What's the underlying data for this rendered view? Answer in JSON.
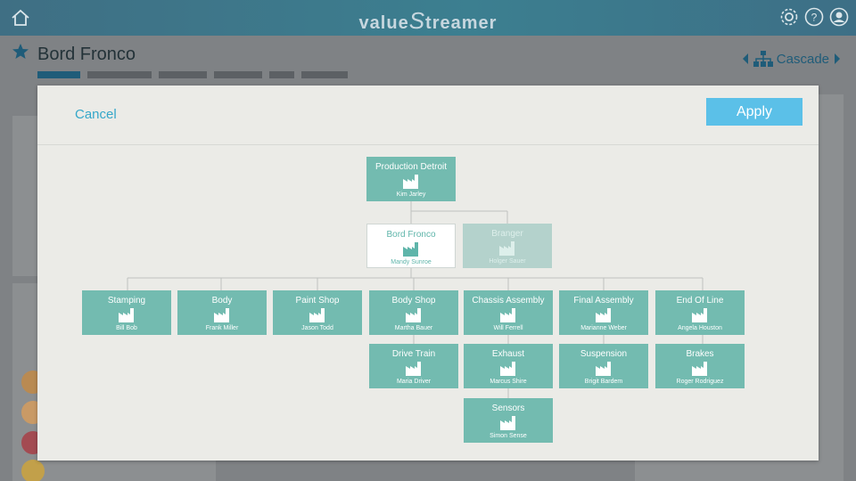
{
  "app": {
    "brand_prefix": "value",
    "brand_s": "S",
    "brand_suffix": "treamer",
    "home_icon": "home-icon",
    "settings_icon": "gear-icon",
    "help_icon": "help-icon",
    "profile_icon": "user-icon"
  },
  "page": {
    "title": "Bord Fronco",
    "cascade_label": "Cascade"
  },
  "modal": {
    "cancel_label": "Cancel",
    "apply_label": "Apply"
  },
  "tree": {
    "root": {
      "name": "Production Detroit",
      "person": "Kim Jarley"
    },
    "level2": [
      {
        "name": "Bord Fronco",
        "person": "Mandy Sunroe",
        "state": "selected"
      },
      {
        "name": "Branger",
        "person": "Holger Sauer",
        "state": "disabled"
      }
    ],
    "level3": [
      {
        "name": "Stamping",
        "person": "Bill Bob"
      },
      {
        "name": "Body",
        "person": "Frank Miller"
      },
      {
        "name": "Paint Shop",
        "person": "Jason Todd"
      },
      {
        "name": "Body Shop",
        "person": "Martha Bauer"
      },
      {
        "name": "Chassis Assembly",
        "person": "Will Ferrell"
      },
      {
        "name": "Final Assembly",
        "person": "Marianne Weber"
      },
      {
        "name": "End Of Line",
        "person": "Angela Houston"
      }
    ],
    "level4": [
      {
        "name": "Drive Train",
        "person": "Maria Driver",
        "parent": "Body Shop"
      },
      {
        "name": "Exhaust",
        "person": "Marcus Shire",
        "parent": "Chassis Assembly"
      },
      {
        "name": "Suspension",
        "person": "Brigit Bardem",
        "parent": "Final Assembly"
      },
      {
        "name": "Brakes",
        "person": "Roger Rodriguez",
        "parent": "End Of Line"
      }
    ],
    "level5": [
      {
        "name": "Sensors",
        "person": "Simon Sense",
        "parent": "Exhaust"
      }
    ],
    "node_icon": "factory-icon"
  },
  "colors": {
    "node": "#73bbb0",
    "node_selected_bg": "#ffffff",
    "node_disabled": "#b4d2cc",
    "apply": "#5bc0e8",
    "cancel": "#35a7c9",
    "topbar": "#3c7f90"
  }
}
